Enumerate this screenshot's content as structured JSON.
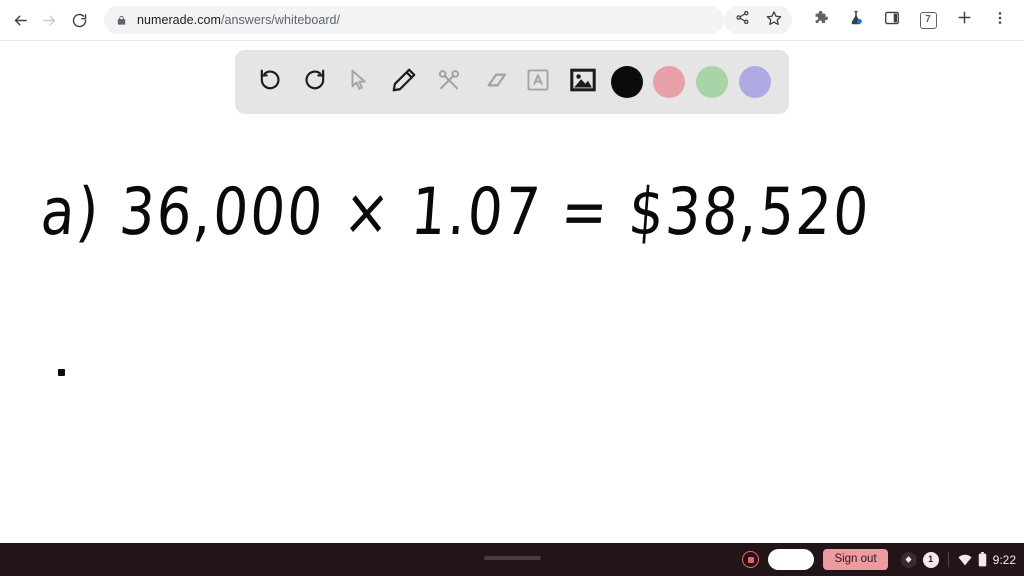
{
  "browser": {
    "back_icon": "back-arrow-icon",
    "forward_icon": "forward-arrow-icon",
    "reload_icon": "reload-icon",
    "lock_icon": "lock-icon",
    "url_host": "numerade.com",
    "url_path": "/answers/whiteboard/",
    "url_full": "numerade.com/answers/whiteboard/",
    "share_icon": "share-icon",
    "bookmark_icon": "star-icon",
    "extensions_icon": "puzzle-piece-icon",
    "experiment_icon": "flask-icon",
    "sidepanel_icon": "side-panel-icon",
    "tab_count": "7",
    "new_tab_icon": "plus-icon",
    "menu_icon": "kebab-menu-icon"
  },
  "whiteboard": {
    "tools": [
      {
        "name": "undo",
        "icon": "undo-icon",
        "state": "enabled"
      },
      {
        "name": "redo",
        "icon": "redo-icon",
        "state": "enabled"
      },
      {
        "name": "select",
        "icon": "cursor-icon",
        "state": "disabled"
      },
      {
        "name": "pencil",
        "icon": "pencil-icon",
        "state": "enabled"
      },
      {
        "name": "cut",
        "icon": "scissors-icon",
        "state": "disabled"
      },
      {
        "name": "eraser",
        "icon": "eraser-icon",
        "state": "disabled"
      },
      {
        "name": "text",
        "icon": "text-a-icon",
        "state": "disabled"
      },
      {
        "name": "image",
        "icon": "image-icon",
        "state": "enabled"
      }
    ],
    "colors": [
      {
        "name": "black",
        "hex": "#0b0b0b",
        "selected": true
      },
      {
        "name": "pink",
        "hex": "#e8a0a8",
        "selected": false
      },
      {
        "name": "green",
        "hex": "#a8d4a8",
        "selected": false
      },
      {
        "name": "periwinkle",
        "hex": "#aeaae4",
        "selected": false
      }
    ],
    "toolbar_bg": "#e5e5e5",
    "ink_color": "#0a0a0a",
    "handwriting": {
      "equation": "a) 36,000 × 1.07 = $38,520",
      "dot": "."
    }
  },
  "shelf": {
    "bg": "#231419",
    "record_icon": "stop-recording-icon",
    "launcher_icon": "launcher-pill-icon",
    "sign_out_label": "Sign out",
    "sign_out_color": "#ed9ba1",
    "tray": {
      "update_icon": "update-badge-icon",
      "notification_count": "1",
      "wifi_icon": "wifi-icon",
      "battery_icon": "battery-icon",
      "time": "9:22"
    }
  }
}
